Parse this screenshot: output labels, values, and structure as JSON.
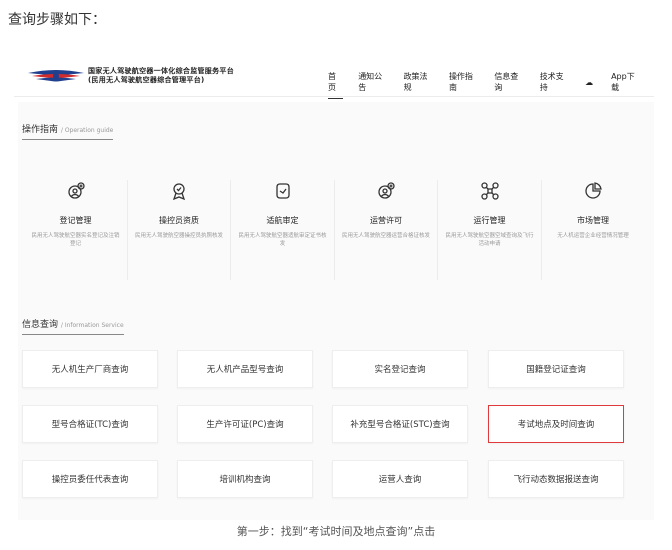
{
  "intro": "查询步骤如下：",
  "header": {
    "brand_line1": "国家无人驾驶航空器一体化综合监管服务平台",
    "brand_line2": "(民用无人驾驶航空器综合管理平台)",
    "nav": [
      "首页",
      "通知公告",
      "政策法规",
      "操作指南",
      "信息查询",
      "技术支持"
    ],
    "app_download": "App下载"
  },
  "guide_section": {
    "title": "操作指南",
    "subtitle": "/ Operation guide",
    "items": [
      {
        "name": "登记管理",
        "desc": "民用无人驾驶航空器实名登记及注销登记",
        "icon": "registration-icon"
      },
      {
        "name": "操控员资质",
        "desc": "民用无人驾驶航空器操控员执照核发",
        "icon": "pilot-badge-icon"
      },
      {
        "name": "适航审定",
        "desc": "民用无人驾驶航空器适航审定证书核发",
        "icon": "airworthiness-icon"
      },
      {
        "name": "运营许可",
        "desc": "民用无人驾驶航空器运营合格证核发",
        "icon": "operation-license-icon"
      },
      {
        "name": "运行管理",
        "desc": "民用无人驾驶航空器空域查询及飞行活动申请",
        "icon": "drone-icon"
      },
      {
        "name": "市场管理",
        "desc": "无人机运营企业经营情况管理",
        "icon": "pie-chart-icon"
      }
    ]
  },
  "info_section": {
    "title": "信息查询",
    "subtitle": "/ Information Service",
    "buttons": [
      "无人机生产厂商查询",
      "无人机产品型号查询",
      "实名登记查询",
      "国籍登记证查询",
      "型号合格证(TC)查询",
      "生产许可证(PC)查询",
      "补充型号合格证(STC)查询",
      "考试地点及时间查询",
      "操控员委任代表查询",
      "培训机构查询",
      "运营人查询",
      "飞行动态数据报送查询"
    ],
    "highlighted": "考试地点及时间查询"
  },
  "caption": "第一步：找到“考试时间及地点查询”点击",
  "colors": {
    "highlight": "#e03a3a",
    "logo_blue": "#1f3f8f",
    "logo_red": "#d22b2b"
  }
}
